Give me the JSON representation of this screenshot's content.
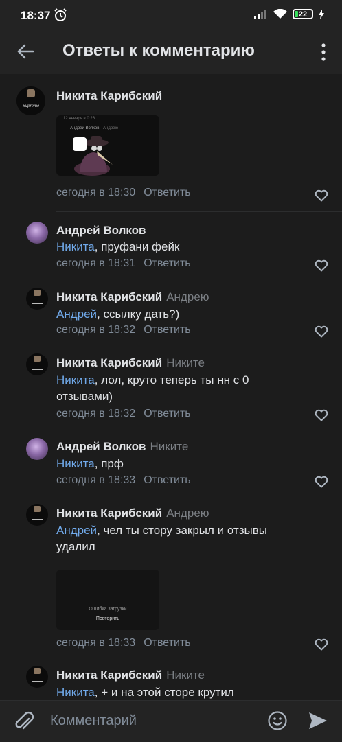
{
  "status_bar": {
    "time": "18:37",
    "battery": "22"
  },
  "header": {
    "title": "Ответы к комментарию"
  },
  "comments": [
    {
      "author": "Никита Карибский",
      "reply_to": "",
      "mention": "",
      "text": "",
      "time": "сегодня в 18:30",
      "reply_label": "Ответить",
      "attachment": {
        "preview_line1": "12 января в 0:26",
        "preview_author": "Андрей Волков",
        "preview_reply": "Андрею"
      }
    },
    {
      "author": "Андрей Волков",
      "reply_to": "",
      "mention": "Никита",
      "text": ", пруфани фейк",
      "time": "сегодня в 18:31",
      "reply_label": "Ответить"
    },
    {
      "author": "Никита Карибский",
      "reply_to": "Андрею",
      "mention": "Андрей",
      "text": ", ссылку дать?)",
      "time": "сегодня в 18:32",
      "reply_label": "Ответить"
    },
    {
      "author": "Никита Карибский",
      "reply_to": "Никите",
      "mention": "Никита",
      "text": ", лол, круто теперь ты нн с 0 отзывами)",
      "time": "сегодня в 18:32",
      "reply_label": "Ответить"
    },
    {
      "author": "Андрей Волков",
      "reply_to": "Никите",
      "mention": "Никита",
      "text": ", прф",
      "time": "сегодня в 18:33",
      "reply_label": "Ответить"
    },
    {
      "author": "Никита Карибский",
      "reply_to": "Андрею",
      "mention": "Андрей",
      "text": ", чел ты стору закрыл и отзывы удалил",
      "time": "сегодня в 18:33",
      "reply_label": "Ответить",
      "attachment": {
        "error_text": "Ошибка загрузки",
        "retry_label": "Повторить"
      }
    },
    {
      "author": "Никита Карибский",
      "reply_to": "Никите",
      "mention": "Никита",
      "text": ", + и на этой сторе крутил",
      "time": "",
      "reply_label": ""
    }
  ],
  "composer": {
    "placeholder": "Комментарий"
  },
  "colors": {
    "background": "#1c1c1c",
    "bar": "#232323",
    "mention": "#71aaeb",
    "secondary": "#818c99"
  }
}
